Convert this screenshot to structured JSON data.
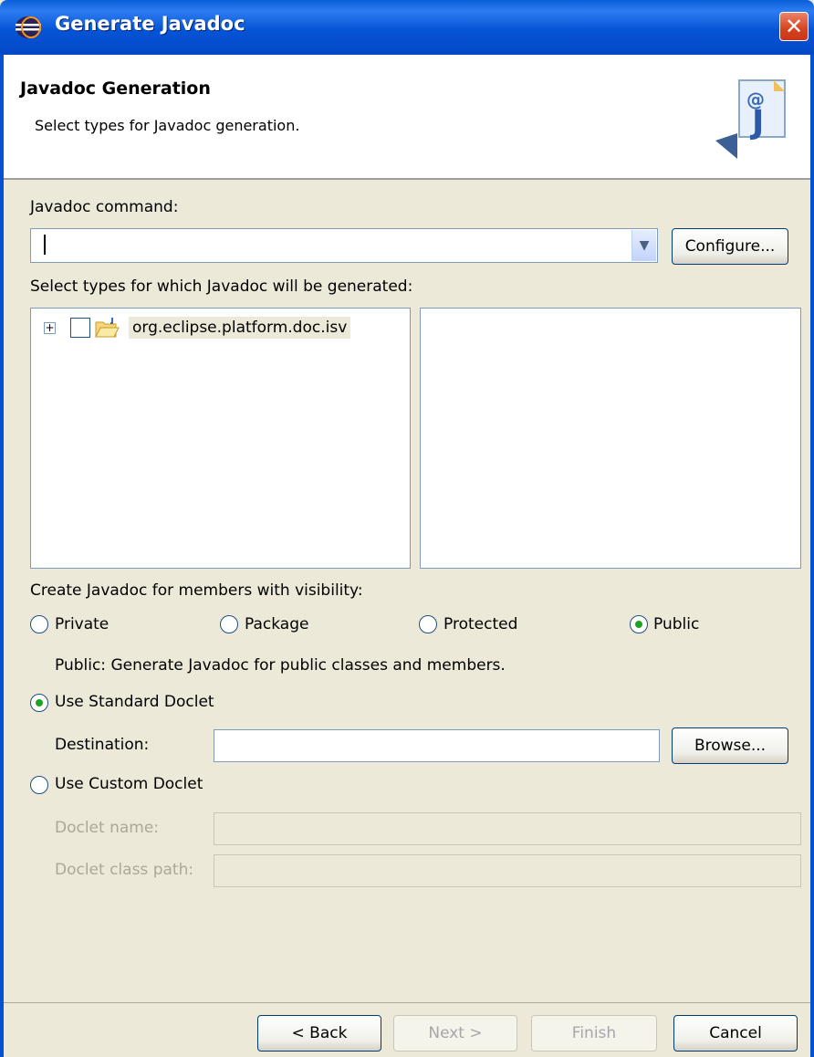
{
  "window": {
    "title": "Generate Javadoc",
    "close_glyph": "✕"
  },
  "banner": {
    "title": "Javadoc Generation",
    "description": "Select types for Javadoc generation.",
    "icon": "javadoc-wizard-icon"
  },
  "javadoc_command": {
    "label": "Javadoc command:",
    "value": "",
    "configure_label": "Configure..."
  },
  "types": {
    "label": "Select types for which Javadoc will be generated:",
    "tree_items": [
      {
        "label": "org.eclipse.platform.doc.isv",
        "expanded": false,
        "checked": false
      }
    ]
  },
  "visibility": {
    "label": "Create Javadoc for members with visibility:",
    "options": [
      {
        "label": "Private",
        "selected": false
      },
      {
        "label": "Package",
        "selected": false
      },
      {
        "label": "Protected",
        "selected": false
      },
      {
        "label": "Public",
        "selected": true
      }
    ],
    "description": "Public: Generate Javadoc for public classes and members."
  },
  "standard_doclet": {
    "label": "Use Standard Doclet",
    "selected": true,
    "destination_label": "Destination:",
    "destination_value": "",
    "browse_label": "Browse..."
  },
  "custom_doclet": {
    "label": "Use Custom Doclet",
    "selected": false,
    "doclet_name_label": "Doclet name:",
    "doclet_classpath_label": "Doclet class path:"
  },
  "footer": {
    "back_label": "< Back",
    "next_label": "Next >",
    "finish_label": "Finish",
    "cancel_label": "Cancel"
  },
  "colors": {
    "titlebar": "#0554d6",
    "dialog_bg": "#ece9d8",
    "radio_dot": "#21a121"
  }
}
